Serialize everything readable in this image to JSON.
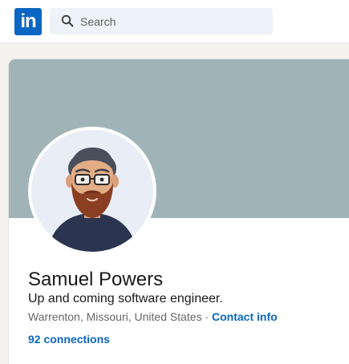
{
  "header": {
    "logo_text": "in",
    "logo_icon": "linkedin-logo",
    "search": {
      "icon": "search-icon",
      "placeholder": "Search"
    }
  },
  "profile": {
    "name": "Samuel Powers",
    "headline": "Up and coming software engineer.",
    "location": "Warrenton, Missouri, United States",
    "separator": " · ",
    "contact_info_label": "Contact info",
    "connections_label": "92 connections"
  },
  "colors": {
    "brand": "#0a66c2",
    "banner": "#a0b4b7",
    "page_background": "#f4f2ee",
    "search_background": "#edf3f8"
  }
}
